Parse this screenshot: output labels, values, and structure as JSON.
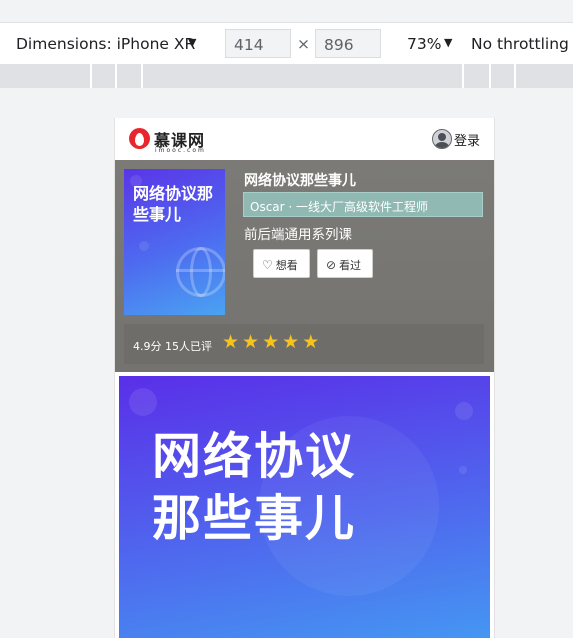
{
  "devtools": {
    "dimensions_label": "Dimensions: iPhone XR",
    "width": "414",
    "times": "×",
    "height": "896",
    "zoom": "73%",
    "throttle": "No throttling",
    "caret": "▼"
  },
  "page": {
    "header": {
      "logo_name": "慕课网",
      "logo_sub": "imooc.com",
      "login_label": "登录"
    },
    "course": {
      "cover_title": "网络协议那些事儿",
      "title": "网络协议那些事儿",
      "teacher": "Oscar · 一线大厂高级软件工程师",
      "series": "前后端通用系列课",
      "want_label": "想看",
      "seen_label": "看过",
      "rating_text": "4.9分 15人已评",
      "rating_value": 5,
      "star_color": "#f7c21b"
    },
    "banner": {
      "line1": "网络协议",
      "line2": "那些事儿"
    }
  }
}
